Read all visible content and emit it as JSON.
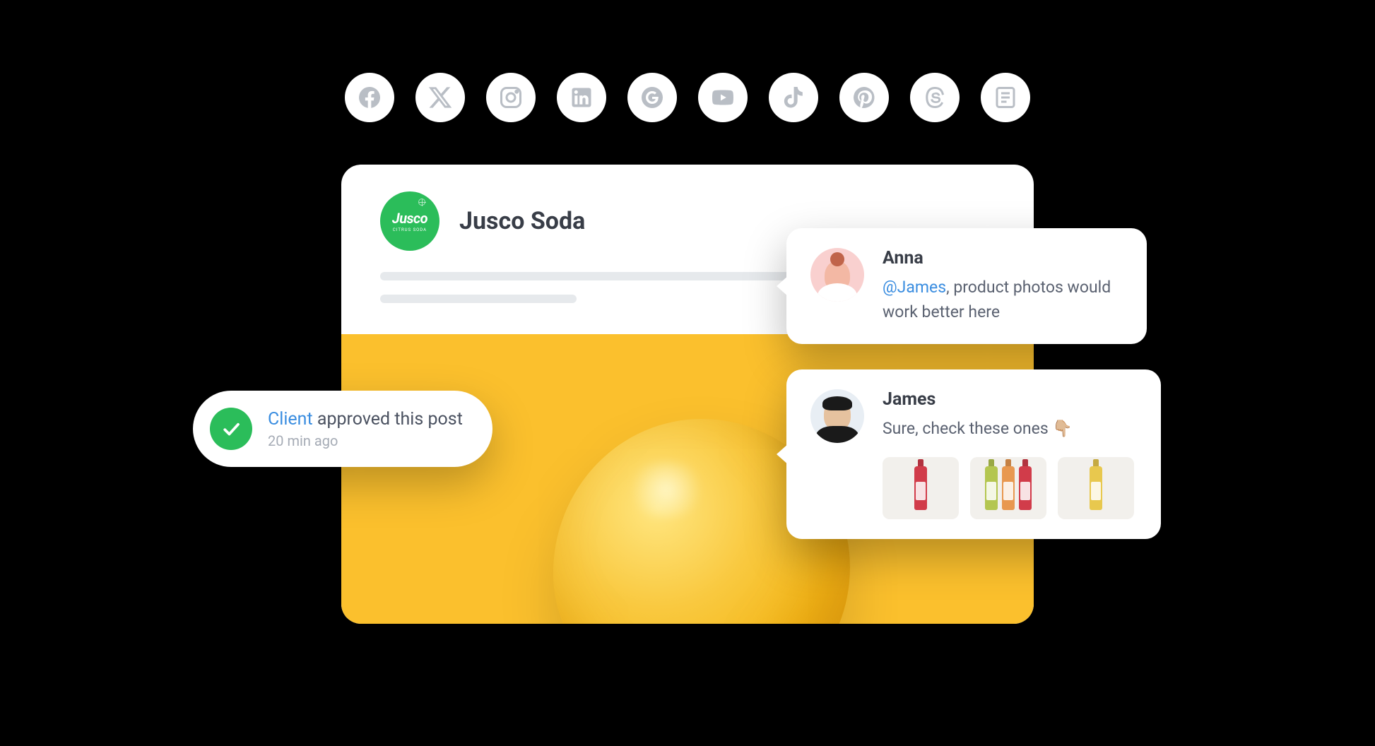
{
  "social_icons": [
    "facebook-icon",
    "x-icon",
    "instagram-icon",
    "linkedin-icon",
    "google-icon",
    "youtube-icon",
    "tiktok-icon",
    "pinterest-icon",
    "threads-icon",
    "blog-icon"
  ],
  "post": {
    "brand_name": "Jusco Soda",
    "brand_logo_text": "Jusco",
    "brand_logo_sub": "CITRUS SODA"
  },
  "approval": {
    "client_label": "Client",
    "action_text": " approved this post",
    "timestamp": "20 min ago"
  },
  "comments": {
    "anna": {
      "name": "Anna",
      "mention": "@James",
      "text": ", product photos would work better here"
    },
    "james": {
      "name": "James",
      "text": "Sure, check these ones ",
      "emoji": "👇🏼"
    }
  }
}
